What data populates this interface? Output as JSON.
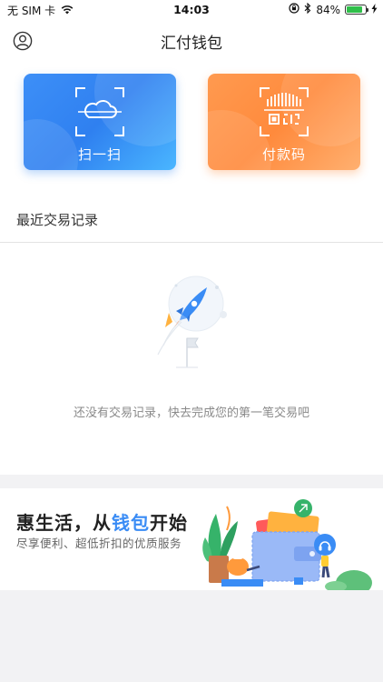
{
  "status_bar": {
    "carrier": "无 SIM 卡",
    "time": "14:03",
    "battery_percent": "84%",
    "battery_level": 0.84,
    "icons": [
      "wifi-icon",
      "orientation-lock-icon",
      "bluetooth-icon",
      "battery-icon",
      "charging-icon"
    ]
  },
  "nav": {
    "title": "汇付钱包",
    "left_icon": "user-icon"
  },
  "actions": [
    {
      "label": "扫一扫",
      "icon": "scan-cloud-icon",
      "color": "#3a8cf5"
    },
    {
      "label": "付款码",
      "icon": "pay-code-icon",
      "color": "#ff8c40"
    }
  ],
  "transactions": {
    "title": "最近交易记录",
    "empty_icon": "rocket-flag-icon",
    "empty_text": "还没有交易记录，快去完成您的第一笔交易吧"
  },
  "promo": {
    "title_prefix": "惠生活，从",
    "title_highlight": "钱包",
    "title_suffix": "开始",
    "subtitle": "尽享便利、超低折扣的优质服务",
    "highlight_color": "#3a8cf5",
    "illustration": "wallet-lifestyle-illustration"
  }
}
